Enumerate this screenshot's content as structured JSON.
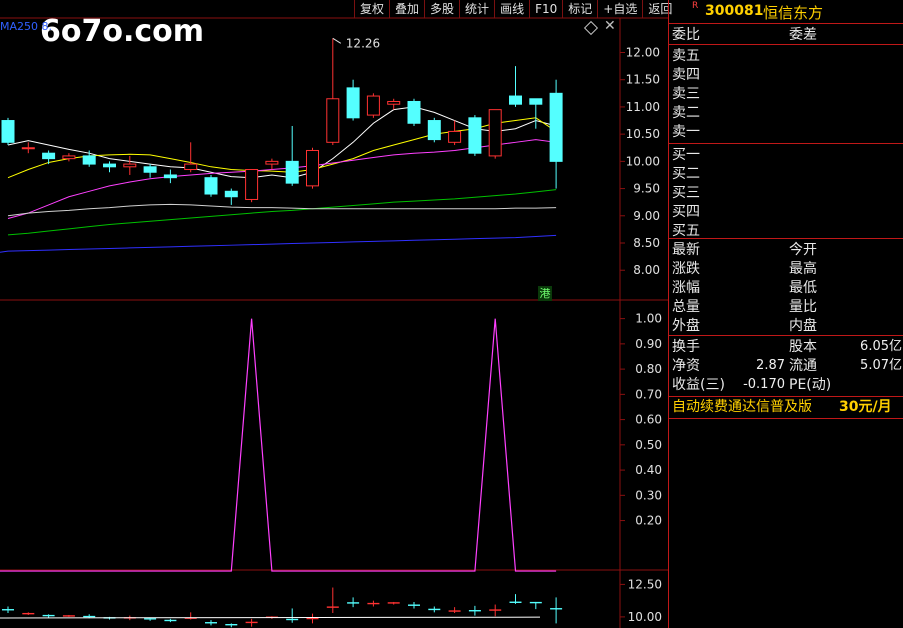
{
  "watermark": "6o7o.com",
  "indicator_label": "MA250  8.",
  "toolbar": [
    "复权",
    "叠加",
    "多股",
    "统计",
    "画线",
    "F10",
    "标记",
    "+自选",
    "返回"
  ],
  "diamond_icon": "diamond-icon",
  "price_high_label": "12.26",
  "hk_badge": "港",
  "stock": {
    "flag": "R",
    "code": "300081",
    "name": "恒信东方"
  },
  "panel": {
    "weibi": "委比",
    "weicha": "委差",
    "sell": [
      "卖五",
      "卖四",
      "卖三",
      "卖二",
      "卖一"
    ],
    "buy": [
      "买一",
      "买二",
      "买三",
      "买四",
      "买五"
    ],
    "stats_left": [
      "最新",
      "涨跌",
      "涨幅",
      "总量",
      "外盘"
    ],
    "stats_right": [
      "今开",
      "最高",
      "最低",
      "量比",
      "内盘"
    ],
    "huanshou": "换手",
    "guben": "股本",
    "guben_val": "6.05亿",
    "jingzi": "净资",
    "jingzi_val": "2.87",
    "liutong": "流通",
    "liutong_val": "5.07亿",
    "shouyi": "收益(三)",
    "shouyi_val": "-0.170",
    "pe": "PE(动)",
    "promo": "自动续费通达信普及版",
    "promo_price": "30元/月"
  },
  "colors": {
    "up": "#ff3232",
    "down": "#54ffff",
    "grid": "#8a1010",
    "ma5": "#ffffff",
    "ma10": "#ffff00",
    "ma20": "#ff40ff",
    "ma60": "#00c000",
    "ma120": "#d0d0d0",
    "ma250": "#3030ff",
    "signal": "#ff40ff",
    "accent": "#ffd000"
  },
  "chart_data": [
    {
      "type": "candlestick",
      "title": "",
      "ylim": [
        7.6,
        12.45
      ],
      "yticks": [
        8.0,
        8.5,
        9.0,
        9.5,
        10.0,
        10.5,
        11.0,
        11.5,
        12.0
      ],
      "candles": [
        {
          "o": 10.75,
          "c": 10.35,
          "h": 10.8,
          "l": 10.3
        },
        {
          "o": 10.25,
          "c": 10.25,
          "h": 10.35,
          "l": 10.15
        },
        {
          "o": 10.15,
          "c": 10.05,
          "h": 10.2,
          "l": 9.95
        },
        {
          "o": 10.05,
          "c": 10.1,
          "h": 10.15,
          "l": 10.0
        },
        {
          "o": 10.1,
          "c": 9.95,
          "h": 10.2,
          "l": 9.9
        },
        {
          "o": 9.95,
          "c": 9.9,
          "h": 10.0,
          "l": 9.8
        },
        {
          "o": 9.9,
          "c": 9.95,
          "h": 10.1,
          "l": 9.75
        },
        {
          "o": 9.9,
          "c": 9.8,
          "h": 9.95,
          "l": 9.7
        },
        {
          "o": 9.75,
          "c": 9.7,
          "h": 9.85,
          "l": 9.6
        },
        {
          "o": 9.85,
          "c": 9.95,
          "h": 10.35,
          "l": 9.8
        },
        {
          "o": 9.7,
          "c": 9.4,
          "h": 9.75,
          "l": 9.35
        },
        {
          "o": 9.45,
          "c": 9.35,
          "h": 9.5,
          "l": 9.2
        },
        {
          "o": 9.3,
          "c": 9.85,
          "h": 9.85,
          "l": 9.25
        },
        {
          "o": 9.95,
          "c": 10.0,
          "h": 10.05,
          "l": 9.85
        },
        {
          "o": 10.0,
          "c": 9.6,
          "h": 10.65,
          "l": 9.55
        },
        {
          "o": 9.55,
          "c": 10.2,
          "h": 10.25,
          "l": 9.5
        },
        {
          "o": 10.35,
          "c": 11.15,
          "h": 12.26,
          "l": 10.3
        },
        {
          "o": 11.35,
          "c": 10.8,
          "h": 11.5,
          "l": 10.75
        },
        {
          "o": 10.85,
          "c": 11.2,
          "h": 11.25,
          "l": 10.8
        },
        {
          "o": 11.05,
          "c": 11.1,
          "h": 11.15,
          "l": 10.95
        },
        {
          "o": 11.1,
          "c": 10.7,
          "h": 11.15,
          "l": 10.65
        },
        {
          "o": 10.75,
          "c": 10.4,
          "h": 10.8,
          "l": 10.35
        },
        {
          "o": 10.35,
          "c": 10.55,
          "h": 10.75,
          "l": 10.3
        },
        {
          "o": 10.8,
          "c": 10.15,
          "h": 10.85,
          "l": 10.1
        },
        {
          "o": 10.1,
          "c": 10.95,
          "h": 10.95,
          "l": 10.05
        },
        {
          "o": 11.2,
          "c": 11.05,
          "h": 11.75,
          "l": 11.0
        },
        {
          "o": 11.15,
          "c": 11.05,
          "h": 11.15,
          "l": 10.6
        },
        {
          "o": 11.25,
          "c": 10.0,
          "h": 11.5,
          "l": 9.5
        }
      ],
      "ma": [
        {
          "name": "MA5",
          "color": "#ffffff",
          "values": [
            10.3,
            10.38,
            10.3,
            10.22,
            10.15,
            10.05,
            10.0,
            9.95,
            9.9,
            9.88,
            9.8,
            9.72,
            9.7,
            9.75,
            9.7,
            9.8,
            10.05,
            10.35,
            10.7,
            10.95,
            11.0,
            10.9,
            10.75,
            10.6,
            10.55,
            10.6,
            10.75,
            10.65
          ]
        },
        {
          "name": "MA10",
          "color": "#ffff00",
          "values": [
            9.7,
            9.85,
            9.98,
            10.05,
            10.1,
            10.12,
            10.13,
            10.12,
            10.05,
            9.98,
            9.9,
            9.85,
            9.83,
            9.82,
            9.8,
            9.85,
            9.95,
            10.05,
            10.2,
            10.3,
            10.4,
            10.5,
            10.55,
            10.6,
            10.7,
            10.75,
            10.8,
            10.55
          ]
        },
        {
          "name": "MA20",
          "color": "#ff40ff",
          "values": [
            8.95,
            9.05,
            9.2,
            9.35,
            9.45,
            9.55,
            9.62,
            9.68,
            9.72,
            9.75,
            9.78,
            9.8,
            9.82,
            9.85,
            9.88,
            9.92,
            9.97,
            10.02,
            10.07,
            10.12,
            10.15,
            10.17,
            10.2,
            10.25,
            10.3,
            10.35,
            10.4,
            10.35
          ]
        },
        {
          "name": "MA60",
          "color": "#00c000",
          "values": [
            8.65,
            8.68,
            8.72,
            8.76,
            8.8,
            8.84,
            8.87,
            8.9,
            8.93,
            8.96,
            8.99,
            9.02,
            9.05,
            9.08,
            9.1,
            9.13,
            9.16,
            9.19,
            9.22,
            9.25,
            9.27,
            9.29,
            9.31,
            9.34,
            9.37,
            9.4,
            9.44,
            9.48
          ]
        },
        {
          "name": "MA120",
          "color": "#d0d0d0",
          "values": [
            9.0,
            9.05,
            9.08,
            9.1,
            9.13,
            9.15,
            9.18,
            9.2,
            9.21,
            9.2,
            9.18,
            9.16,
            9.15,
            9.15,
            9.14,
            9.13,
            9.13,
            9.13,
            9.13,
            9.13,
            9.13,
            9.13,
            9.13,
            9.13,
            9.13,
            9.14,
            9.14,
            9.15
          ]
        },
        {
          "name": "MA250",
          "color": "#3030ff",
          "values": [
            8.35,
            8.36,
            8.37,
            8.38,
            8.39,
            8.4,
            8.41,
            8.42,
            8.43,
            8.44,
            8.45,
            8.46,
            8.47,
            8.48,
            8.49,
            8.5,
            8.51,
            8.52,
            8.53,
            8.54,
            8.55,
            8.56,
            8.57,
            8.58,
            8.59,
            8.6,
            8.62,
            8.64
          ]
        }
      ]
    },
    {
      "type": "line",
      "title": "",
      "ylim": [
        0.02,
        1.05
      ],
      "yticks": [
        0.2,
        0.3,
        0.4,
        0.5,
        0.6,
        0.7,
        0.8,
        0.9,
        1.0
      ],
      "series": [
        {
          "values": [
            0,
            0,
            0,
            0,
            0,
            0,
            0,
            0,
            0,
            0,
            0,
            0,
            1,
            0,
            0,
            0,
            0,
            0,
            0,
            0,
            0,
            0,
            0,
            0,
            1,
            0,
            0,
            0
          ]
        }
      ]
    },
    {
      "type": "candlestick",
      "title": "",
      "ylim": [
        9.3,
        13.3
      ],
      "yticks": [
        10.0,
        12.5
      ]
    }
  ]
}
